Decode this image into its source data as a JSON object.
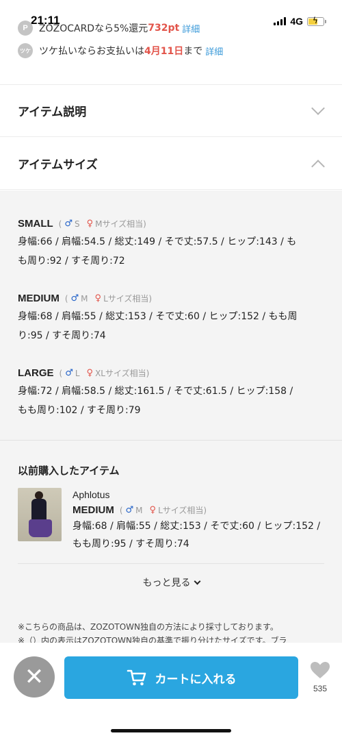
{
  "status_bar": {
    "time": "21:11",
    "network": "4G"
  },
  "promo": {
    "card": {
      "icon": "P",
      "text_before": "ZOZOCARDなら5%還元 ",
      "highlight": "732pt",
      "link": "詳細"
    },
    "tsuke": {
      "icon": "ツケ",
      "text_before": "ツケ払いならお支払いは",
      "highlight": "4月11日",
      "text_after": "まで",
      "link": "詳細"
    }
  },
  "accordions": {
    "description": {
      "title": "アイテム説明"
    },
    "size": {
      "title": "アイテムサイズ"
    }
  },
  "sizes": [
    {
      "name": "SMALL",
      "male": "S",
      "female": "Mサイズ相当",
      "line1": "身幅:66 / 肩幅:54.5 / 総丈:149 / そで丈:57.5 / ヒップ:143 / も",
      "line2": "も周り:92 / すそ周り:72"
    },
    {
      "name": "MEDIUM",
      "male": "M",
      "female": "Lサイズ相当",
      "line1": "身幅:68 / 肩幅:55 / 総丈:153 / そで丈:60 / ヒップ:152 / もも周",
      "line2": "り:95 / すそ周り:74"
    },
    {
      "name": "LARGE",
      "male": "L",
      "female": "XLサイズ相当",
      "line1": "身幅:72 / 肩幅:58.5 / 総丈:161.5 / そで丈:61.5 / ヒップ:158 /",
      "line2": "もも周り:102 / すそ周り:79"
    }
  ],
  "history": {
    "title": "以前購入したアイテム",
    "brand": "Aphlotus",
    "size_name": "MEDIUM",
    "male": "M",
    "female": "Lサイズ相当",
    "line1": "身幅:68 / 肩幅:55 / 総丈:153 / そで丈:60 / ヒップ:152 /",
    "line2": "もも周り:95 / すそ周り:74",
    "more": "もっと見る"
  },
  "notes": [
    "※こちらの商品は、ZOZOTOWN独自の方法により採寸しております。",
    "※（）内の表示はZOZOTOWN独自の基準で振り分けたサイズです。ブラ"
  ],
  "bottom": {
    "close": "✕",
    "cart_label": "カートに入れる",
    "fav_count": "535"
  },
  "colors": {
    "accent": "#2aa6e0",
    "red": "#e2544a",
    "link": "#3b9ad9"
  }
}
